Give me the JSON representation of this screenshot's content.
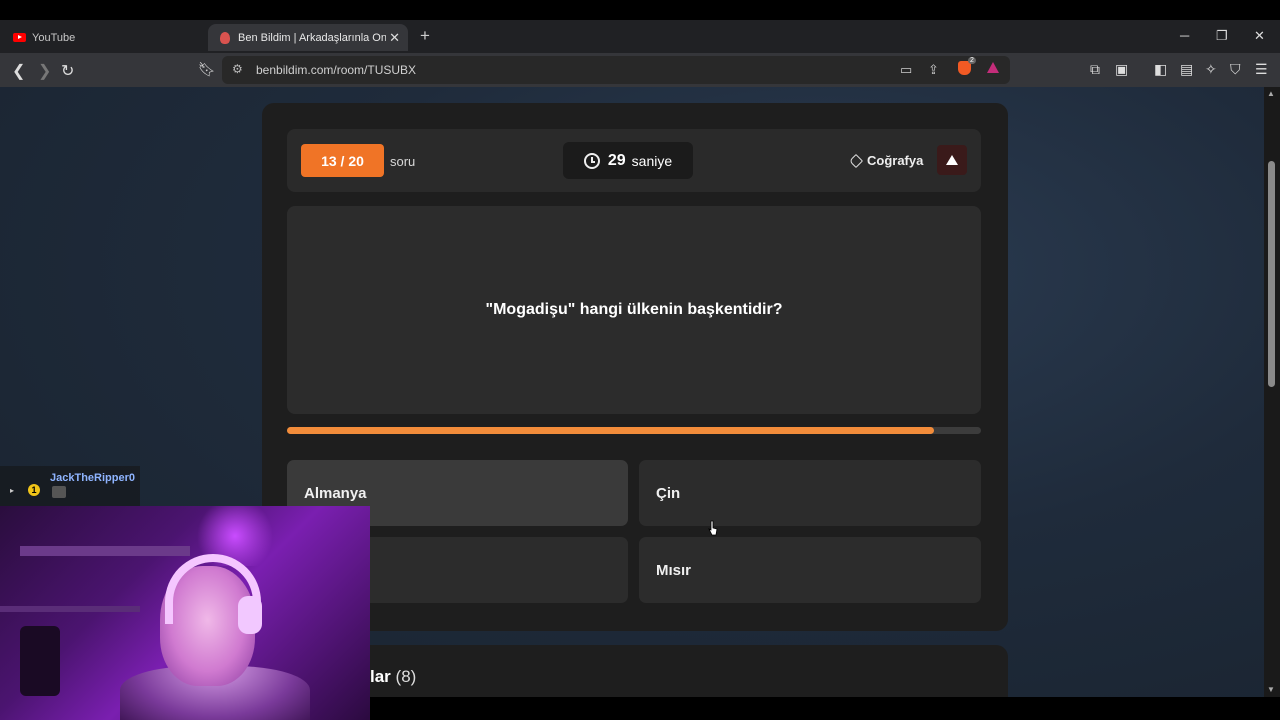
{
  "browser": {
    "tabs": [
      {
        "label": "YouTube",
        "icon": "youtube-icon",
        "active": false
      },
      {
        "label": "Ben Bildim | Arkadaşlarınla Online",
        "icon": "benbildim-icon",
        "active": true
      }
    ],
    "url": "benbildim.com/room/TUSUBX"
  },
  "quiz": {
    "question_counter": "13 / 20",
    "counter_suffix": "soru",
    "timer_value": "29",
    "timer_unit": "saniye",
    "category": "Coğrafya",
    "question": "\"Mogadişu\" hangi ülkenin başkentidir?",
    "progress_fraction": 0.932,
    "answers": [
      "Almanya",
      "Çin",
      "",
      "Mısır"
    ],
    "players_title_partial": "lar",
    "players_count": "(8)"
  },
  "stream_overlay": {
    "chat_username": "JackTheRipper0",
    "chat_badge": "1"
  },
  "colors": {
    "accent": "#f07426",
    "progress": "#f28c3a",
    "panel": "#1e1e1e",
    "card": "#2c2c2c"
  }
}
